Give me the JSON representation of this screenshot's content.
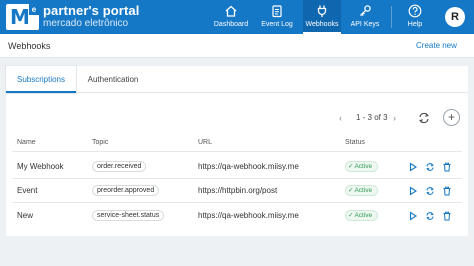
{
  "brand": {
    "title": "partner's portal",
    "subtitle": "mercado eletrônico",
    "logo_letters": "M",
    "logo_badge": "e"
  },
  "nav": [
    {
      "label": "Dashboard",
      "icon": "home-icon",
      "active": false
    },
    {
      "label": "Event Log",
      "icon": "event-log-icon",
      "active": false
    },
    {
      "label": "Webhooks",
      "icon": "plug-icon",
      "active": true
    },
    {
      "label": "API Keys",
      "icon": "key-icon",
      "active": false
    },
    {
      "label": "Help",
      "icon": "help-icon",
      "active": false
    }
  ],
  "user": {
    "initial": "R"
  },
  "page": {
    "title": "Webhooks",
    "create_new": "Create new"
  },
  "tabs": [
    {
      "label": "Subscriptions",
      "active": true
    },
    {
      "label": "Authentication",
      "active": false
    }
  ],
  "pager": {
    "text": "1 - 3 of 3",
    "prev": "‹",
    "next": "›"
  },
  "add_label": "+",
  "table": {
    "headers": [
      "Name",
      "Topic",
      "URL",
      "Status"
    ],
    "rows": [
      {
        "name": "My Webhook",
        "topic": "order.received",
        "url": "https://qa-webhook.miisy.me",
        "status": "Active"
      },
      {
        "name": "Event",
        "topic": "preorder.approved",
        "url": "https://httpbin.org/post",
        "status": "Active"
      },
      {
        "name": "New",
        "topic": "service-sheet.status",
        "url": "https://qa-webhook.miisy.me",
        "status": "Active"
      }
    ]
  },
  "colors": {
    "primary": "#1578c7",
    "status_active": "#2e9b55",
    "background": "#eef1f4"
  }
}
